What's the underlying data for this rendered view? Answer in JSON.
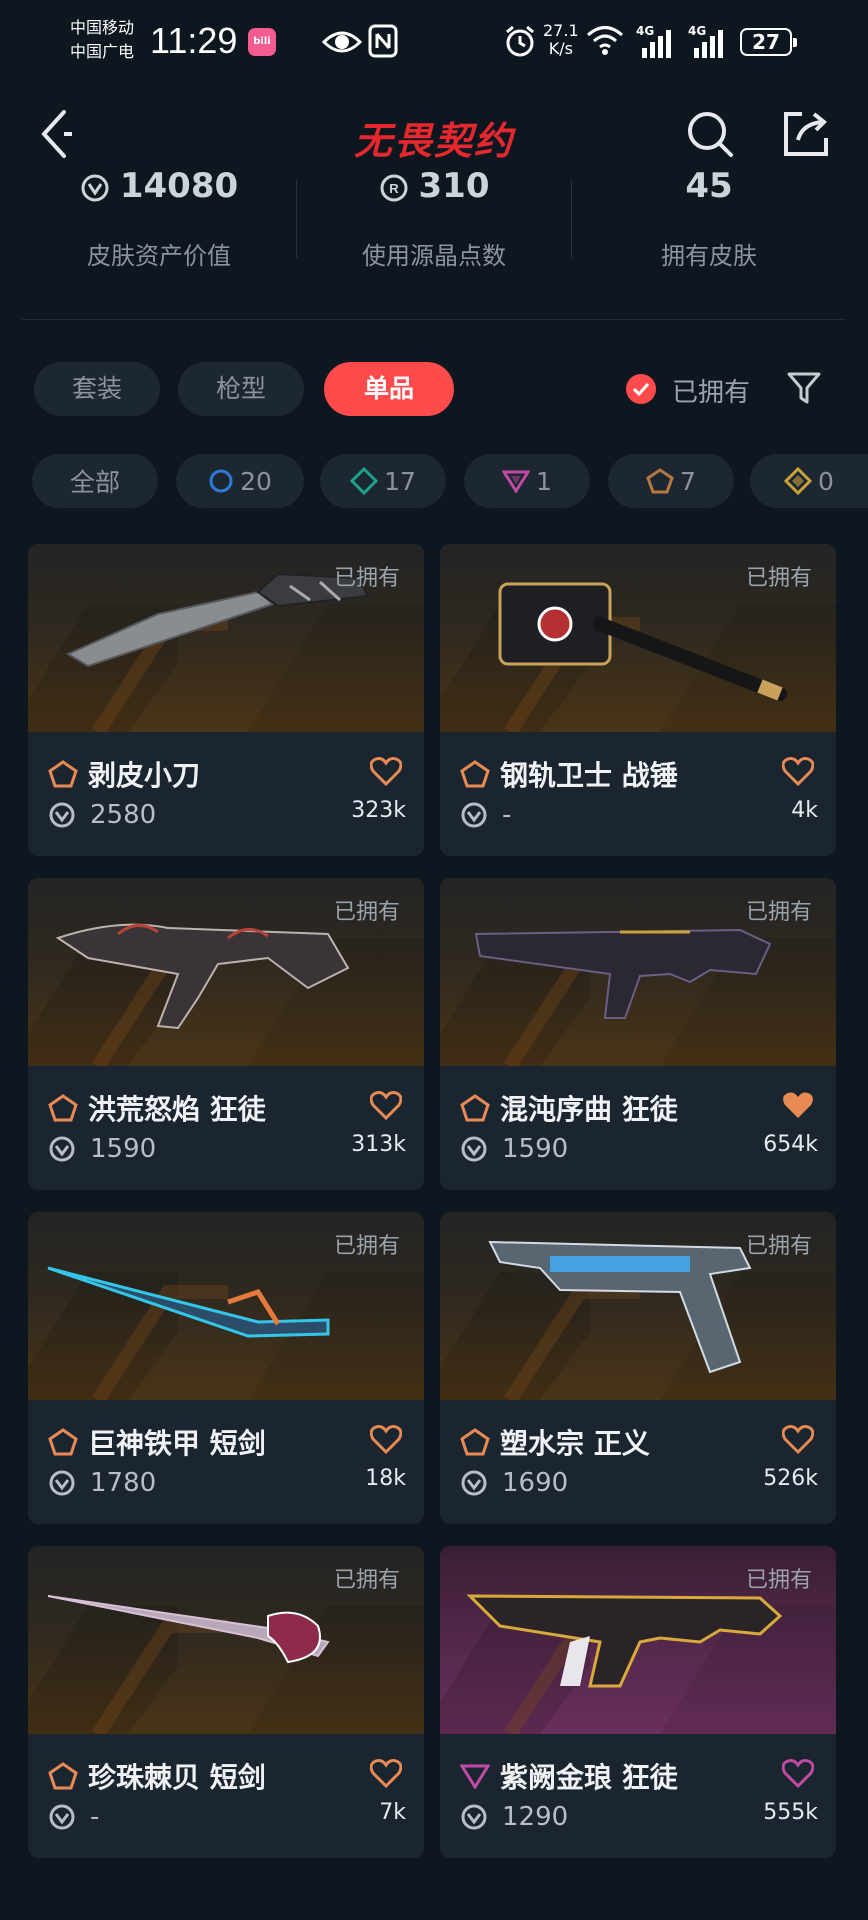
{
  "status_bar": {
    "carrier1": "中国移动",
    "carrier2": "中国广电",
    "time": "11:29",
    "app_badge": "bilibili",
    "net_speed_value": "27.1",
    "net_speed_unit": "K/s",
    "signal1": "4G",
    "signal2": "4G",
    "battery": "27"
  },
  "header": {
    "logo_text": "无畏契约"
  },
  "stats": [
    {
      "value": "14080",
      "label": "皮肤资产价值",
      "icon": "vp-currency-icon"
    },
    {
      "value": "310",
      "label": "使用源晶点数",
      "icon": "radianite-icon"
    },
    {
      "value": "45",
      "label": "拥有皮肤",
      "icon": ""
    }
  ],
  "tabs": [
    {
      "label": "套装",
      "active": false
    },
    {
      "label": "枪型",
      "active": false
    },
    {
      "label": "单品",
      "active": true
    }
  ],
  "owned_filter": {
    "label": "已拥有",
    "checked": true
  },
  "rarity_chips": [
    {
      "label": "全部",
      "count": "",
      "color": ""
    },
    {
      "label": "",
      "count": "20",
      "color": "#2d7bd6"
    },
    {
      "label": "",
      "count": "17",
      "color": "#1aa38a"
    },
    {
      "label": "",
      "count": "1",
      "color": "#c04aa4"
    },
    {
      "label": "",
      "count": "7",
      "color": "#b7773e"
    },
    {
      "label": "",
      "count": "0",
      "color": "#c9a23a"
    }
  ],
  "cards": [
    {
      "name": "剥皮小刀",
      "price": "2580",
      "likes": "323k",
      "owned": "已拥有",
      "tier": "exclusive",
      "liked": false
    },
    {
      "name": "钢轨卫士 战锤",
      "price": "-",
      "likes": "4k",
      "owned": "已拥有",
      "tier": "exclusive",
      "liked": false
    },
    {
      "name": "洪荒怒焰 狂徒",
      "price": "1590",
      "likes": "313k",
      "owned": "已拥有",
      "tier": "exclusive",
      "liked": false
    },
    {
      "name": "混沌序曲 狂徒",
      "price": "1590",
      "likes": "654k",
      "owned": "已拥有",
      "tier": "exclusive",
      "liked": true
    },
    {
      "name": "巨神铁甲 短剑",
      "price": "1780",
      "likes": "18k",
      "owned": "已拥有",
      "tier": "exclusive",
      "liked": false
    },
    {
      "name": "塑水宗 正义",
      "price": "1690",
      "likes": "526k",
      "owned": "已拥有",
      "tier": "exclusive",
      "liked": false
    },
    {
      "name": "珍珠棘贝 短剑",
      "price": "-",
      "likes": "7k",
      "owned": "已拥有",
      "tier": "exclusive",
      "liked": false
    },
    {
      "name": "紫阙金琅 狂徒",
      "price": "1290",
      "likes": "555k",
      "owned": "已拥有",
      "tier": "premium",
      "liked": false
    }
  ],
  "colors": {
    "accent": "#ff4b4b",
    "exclusive_tier": "#e88a54",
    "premium_tier": "#c04aa4",
    "background": "#0e1720"
  }
}
